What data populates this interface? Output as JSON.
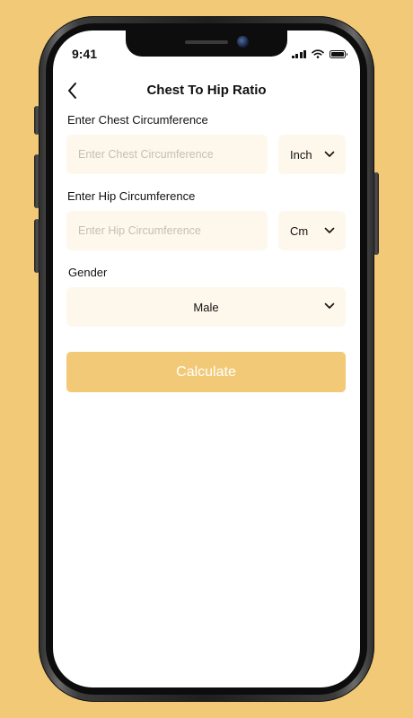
{
  "status_bar": {
    "time": "9:41"
  },
  "header": {
    "title": "Chest To Hip Ratio"
  },
  "form": {
    "chest": {
      "label": "Enter Chest Circumference",
      "placeholder": "Enter Chest Circumference",
      "unit": "Inch"
    },
    "hip": {
      "label": "Enter Hip Circumference",
      "placeholder": "Enter Hip Circumference",
      "unit": "Cm"
    },
    "gender": {
      "label": "Gender",
      "value": "Male"
    },
    "calculate_label": "Calculate"
  },
  "colors": {
    "background": "#F2C977",
    "field_bg": "#FEF8EC",
    "button": "#F2C977"
  }
}
